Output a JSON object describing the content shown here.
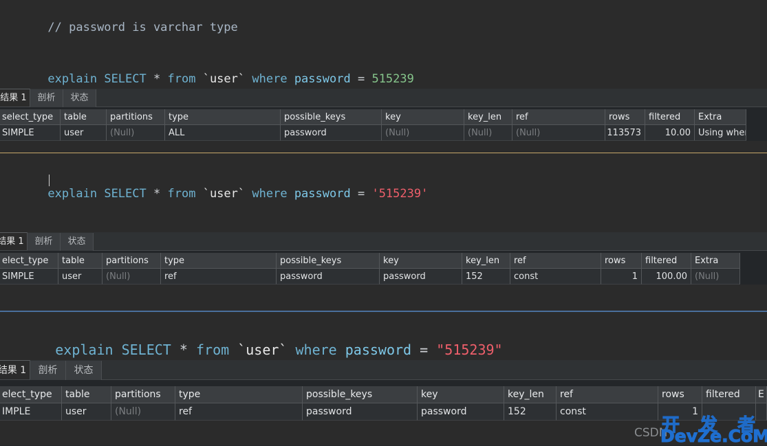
{
  "panes": [
    {
      "comment": "// password is varchar type",
      "sql": {
        "kw1": "explain",
        "kw2": "SELECT",
        "star": "*",
        "kw3": "from",
        "table": "`user`",
        "kw4": "where",
        "column": "password",
        "eq": "=",
        "value": "515239",
        "value_kind": "number"
      },
      "tabs": [
        {
          "label": "结果 1",
          "active": true
        },
        {
          "label": "剖析",
          "active": false
        },
        {
          "label": "状态",
          "active": false
        }
      ],
      "grid": {
        "columns": [
          "select_type",
          "table",
          "partitions",
          "type",
          "possible_keys",
          "key",
          "key_len",
          "ref",
          "rows",
          "filtered",
          "Extra"
        ],
        "rows": [
          [
            "SIMPLE",
            "user",
            "(Null)",
            "ALL",
            "password",
            "(Null)",
            "(Null)",
            "(Null)",
            "113573",
            "10.00",
            "Using wher"
          ]
        ]
      }
    },
    {
      "comment": "",
      "sql": {
        "kw1": "explain",
        "kw2": "SELECT",
        "star": "*",
        "kw3": "from",
        "table": "`user`",
        "kw4": "where",
        "column": "password",
        "eq": "=",
        "value": "'515239'",
        "value_kind": "string"
      },
      "tabs": [
        {
          "label": "结果 1",
          "active": true
        },
        {
          "label": "剖析",
          "active": false
        },
        {
          "label": "状态",
          "active": false
        }
      ],
      "grid": {
        "columns": [
          "elect_type",
          "table",
          "partitions",
          "type",
          "possible_keys",
          "key",
          "key_len",
          "ref",
          "rows",
          "filtered",
          "Extra"
        ],
        "rows": [
          [
            "SIMPLE",
            "user",
            "(Null)",
            "ref",
            "password",
            "password",
            "152",
            "const",
            "1",
            "100.00",
            "(Null)"
          ]
        ]
      }
    },
    {
      "comment": "",
      "sql": {
        "kw1": "explain",
        "kw2": "SELECT",
        "star": "*",
        "kw3": "from",
        "table": "`user`",
        "kw4": "where",
        "column": "password",
        "eq": "=",
        "value": "\"515239\"",
        "value_kind": "string"
      },
      "tabs": [
        {
          "label": "结果 1",
          "active": true
        },
        {
          "label": "剖析",
          "active": false
        },
        {
          "label": "状态",
          "active": false
        }
      ],
      "grid": {
        "columns": [
          "elect_type",
          "table",
          "partitions",
          "type",
          "possible_keys",
          "key",
          "key_len",
          "ref",
          "rows",
          "filtered",
          "E"
        ],
        "rows": [
          [
            "IMPLE",
            "user",
            "(Null)",
            "ref",
            "password",
            "password",
            "152",
            "const",
            "1",
            "",
            ""
          ]
        ]
      }
    }
  ],
  "watermark": {
    "chinese": "开 发 者",
    "english": "DevZe.CoM",
    "csdn": "CSDN"
  },
  "colors": {
    "editor_bg": "#2b2b2b",
    "keyword": "#6fb3d2",
    "number": "#86c58b",
    "string": "#ef5f6b",
    "comment": "#a9b7c6",
    "grid_header_bg": "#3b3e41",
    "grid_row_bg": "#2d3033",
    "separator_tan": "#c9a96a",
    "separator_blue": "#4a6f9c",
    "watermark": "#1f6fd0"
  }
}
